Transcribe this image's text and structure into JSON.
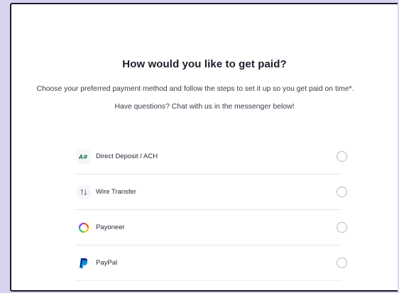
{
  "heading": "How would you like to get paid?",
  "subtitle": "Choose your preferred payment method and follow the steps to set it up so you get paid on time*.",
  "help_text": "Have questions? Chat with us in the messenger below!",
  "methods": [
    {
      "label": "Direct Deposit / ACH",
      "icon": "ach-icon",
      "selected": false
    },
    {
      "label": "Wire Transfer",
      "icon": "wire-transfer-icon",
      "selected": false
    },
    {
      "label": "Payoneer",
      "icon": "payoneer-icon",
      "selected": false
    },
    {
      "label": "PayPal",
      "icon": "paypal-icon",
      "selected": false
    }
  ],
  "colors": {
    "background": "#d9d3f0",
    "card": "#ffffff",
    "border": "#1c1c2e",
    "ach_green": "#1e7d4a",
    "paypal_blue": "#003087",
    "paypal_light": "#009cde"
  }
}
